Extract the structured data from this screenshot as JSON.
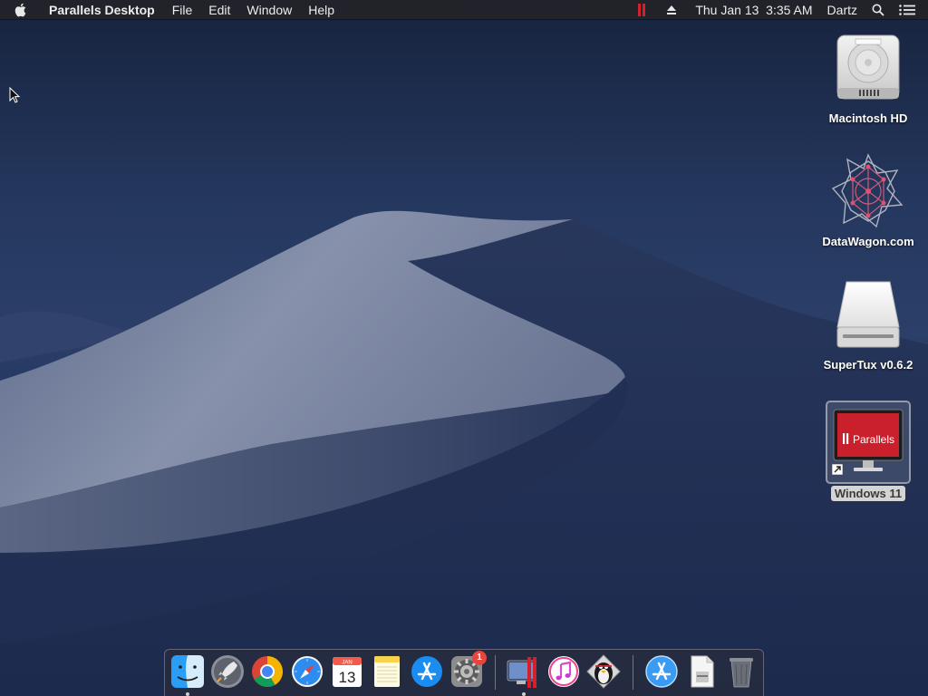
{
  "menubar": {
    "app_name": "Parallels Desktop",
    "menus": [
      "File",
      "Edit",
      "Window",
      "Help"
    ],
    "clock": "Thu Jan 13  3:35 AM",
    "user": "Dartz",
    "icons": [
      "apple-icon",
      "parallels-status-icon",
      "eject-icon",
      "spotlight-icon",
      "notification-center-icon"
    ]
  },
  "desktop_icons": [
    {
      "label": "Macintosh HD",
      "icon": "hard-drive-icon"
    },
    {
      "label": "DataWagon.com",
      "icon": "datawagon-icon"
    },
    {
      "label": "SuperTux v0.6.2",
      "icon": "disk-image-icon"
    },
    {
      "label": "Windows 11",
      "icon": "parallels-vm-icon",
      "selected": true
    }
  ],
  "dock": {
    "items": [
      {
        "name": "Finder",
        "icon": "finder-icon",
        "running": true
      },
      {
        "name": "Launchpad",
        "icon": "launchpad-icon"
      },
      {
        "name": "Google Chrome",
        "icon": "chrome-icon"
      },
      {
        "name": "Safari",
        "icon": "safari-icon"
      },
      {
        "name": "Calendar",
        "icon": "calendar-icon",
        "month": "JAN",
        "day": "13"
      },
      {
        "name": "Notes",
        "icon": "notes-icon"
      },
      {
        "name": "App Store",
        "icon": "app-store-icon"
      },
      {
        "name": "System Preferences",
        "icon": "system-preferences-icon",
        "badge": "1"
      },
      {
        "name": "Parallels Desktop",
        "icon": "parallels-desktop-icon",
        "running": true
      },
      {
        "name": "iTunes",
        "icon": "itunes-icon"
      },
      {
        "name": "SuperTux",
        "icon": "supertux-icon"
      },
      {
        "name": "Applications",
        "icon": "applications-folder-icon"
      },
      {
        "name": "Document",
        "icon": "document-icon"
      },
      {
        "name": "Trash",
        "icon": "trash-icon"
      }
    ]
  },
  "colors": {
    "menubar_bg": "#242428",
    "parallels_red": "#d4202c",
    "selection_label_bg": "#d4d4d4"
  }
}
